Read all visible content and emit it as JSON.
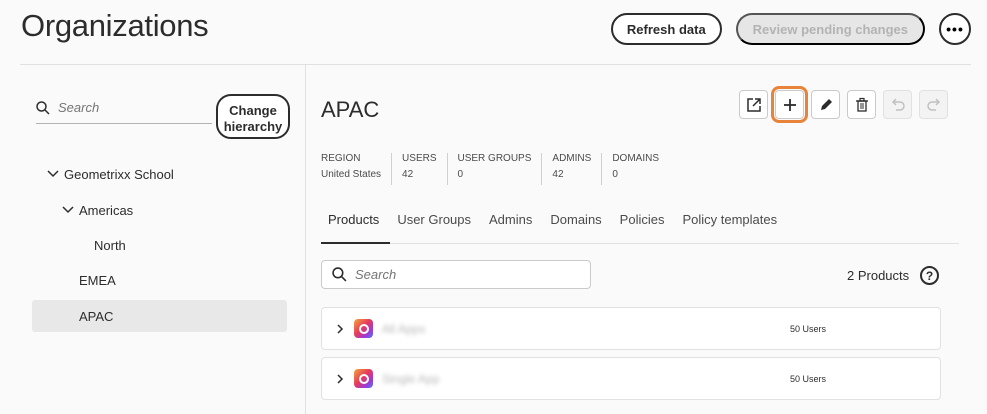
{
  "header": {
    "title": "Organizations",
    "refresh_label": "Refresh data",
    "review_label": "Review pending changes",
    "more_label": "•••"
  },
  "tree": {
    "search_placeholder": "Search",
    "change_hierarchy_label": "Change hierarchy",
    "items": [
      {
        "label": "Geometrixx School",
        "expanded": true
      },
      {
        "label": "Americas",
        "expanded": true
      },
      {
        "label": "North"
      },
      {
        "label": "EMEA"
      },
      {
        "label": "APAC",
        "selected": true
      }
    ]
  },
  "detail": {
    "name": "APAC",
    "toolbar_icons": [
      "open-external-icon",
      "add-icon",
      "edit-icon",
      "delete-icon",
      "undo-icon",
      "redo-icon"
    ],
    "stats": [
      {
        "label": "REGION",
        "value": "United States"
      },
      {
        "label": "USERS",
        "value": "42"
      },
      {
        "label": "USER GROUPS",
        "value": "0"
      },
      {
        "label": "ADMINS",
        "value": "42"
      },
      {
        "label": "DOMAINS",
        "value": "0"
      }
    ],
    "tabs": [
      "Products",
      "User Groups",
      "Admins",
      "Domains",
      "Policies",
      "Policy templates"
    ],
    "active_tab": "Products",
    "search_placeholder": "Search",
    "product_count": "2 Products",
    "help_label": "?",
    "products": [
      {
        "name": "All Apps",
        "users": "50 Users"
      },
      {
        "name": "Single App",
        "users": "50 Users"
      }
    ]
  },
  "colors": {
    "highlight": "#e8833a",
    "text": "#2c2c2c",
    "disabled_bg": "#e6e6e6"
  }
}
